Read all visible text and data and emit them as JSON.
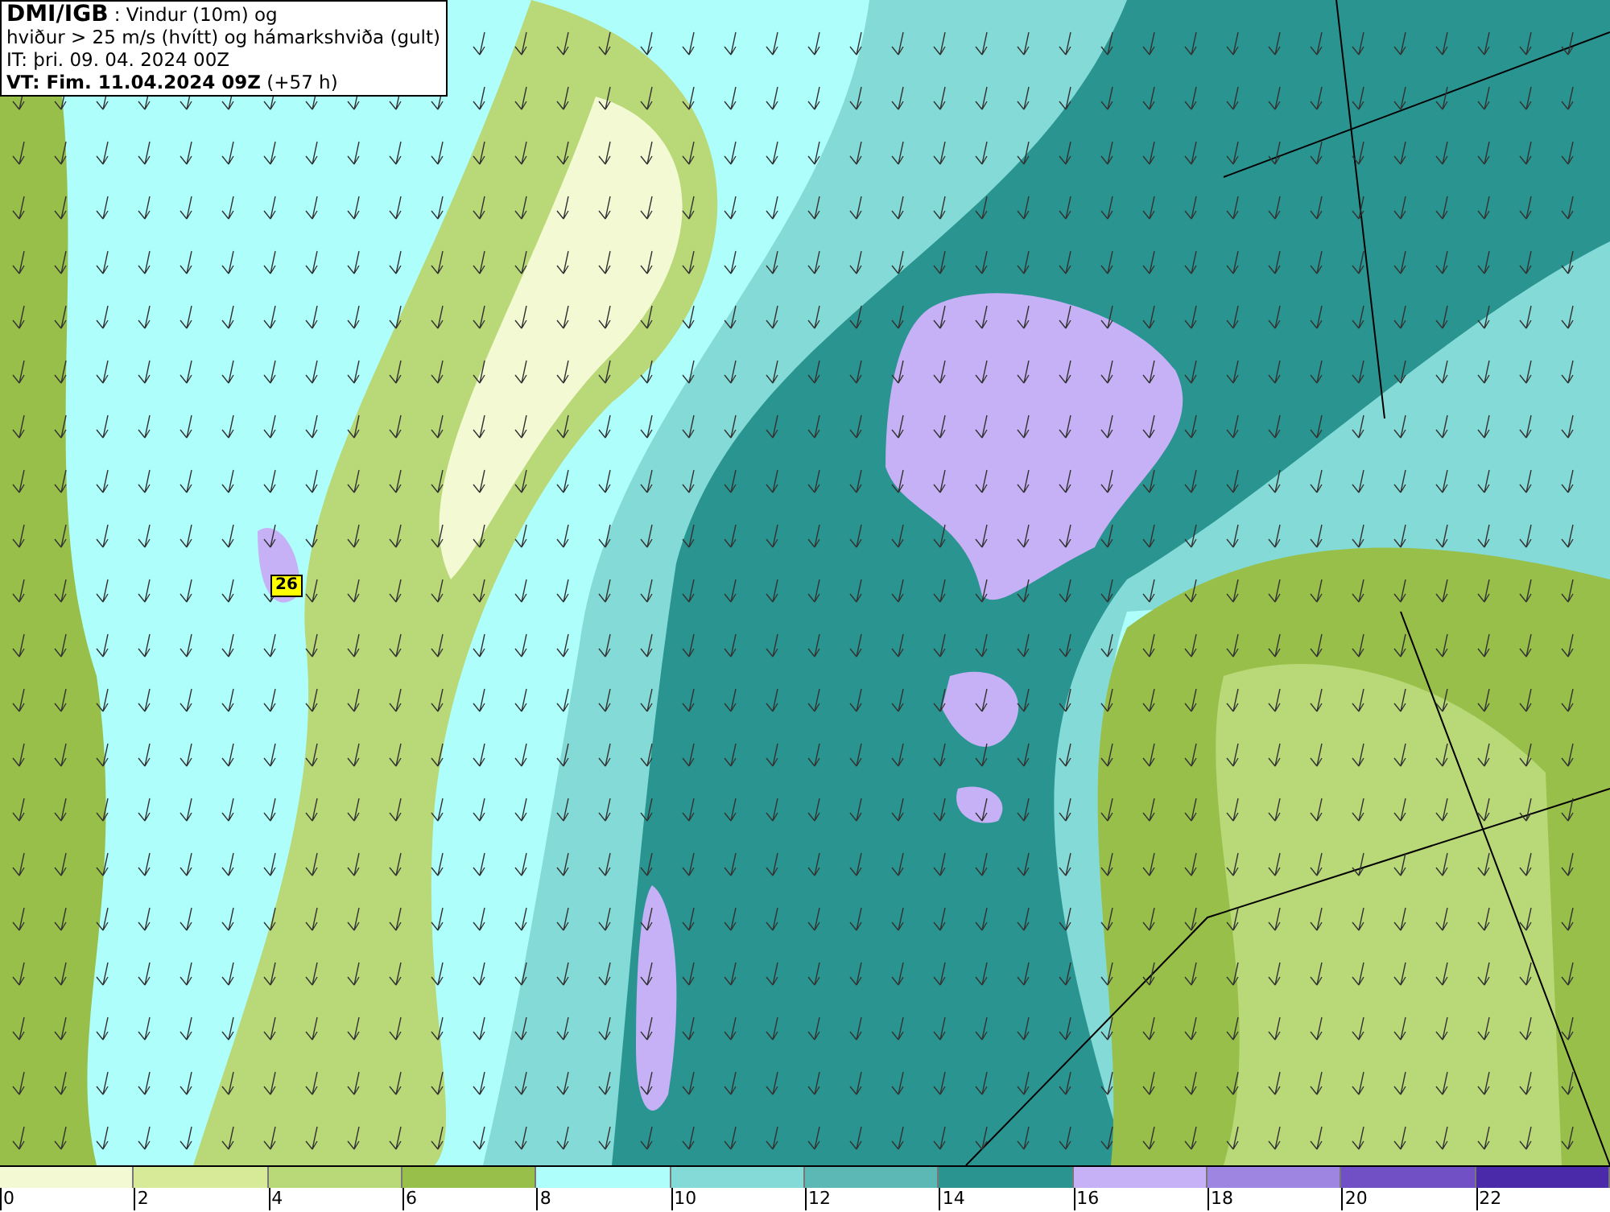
{
  "header": {
    "source": "DMI/IGB",
    "title_rest": " : Vindur (10m) og",
    "line_2": "hviður > 25 m/s (hvítt) og hámarkshviða (gult)",
    "issue_time": "IT: þri. 09. 04. 2024 00Z",
    "valid_time": "VT: Fim. 11.04.2024 09Z",
    "offset": "(+57 h)"
  },
  "map": {
    "max_gust_label": "26"
  },
  "legend": [
    {
      "label": "0",
      "color": "#f3f9d2"
    },
    {
      "label": "2",
      "color": "#d6ea98"
    },
    {
      "label": "4",
      "color": "#b9d877"
    },
    {
      "label": "6",
      "color": "#98bf4a"
    },
    {
      "label": "8",
      "color": "#aefefb"
    },
    {
      "label": "10",
      "color": "#84dad6"
    },
    {
      "label": "12",
      "color": "#5bb8b4"
    },
    {
      "label": "14",
      "color": "#2a9490"
    },
    {
      "label": "16",
      "color": "#c6b0f6"
    },
    {
      "label": "18",
      "color": "#9f85e2"
    },
    {
      "label": "20",
      "color": "#7150c6"
    },
    {
      "label": "22",
      "color": "#4a2aa8"
    }
  ]
}
